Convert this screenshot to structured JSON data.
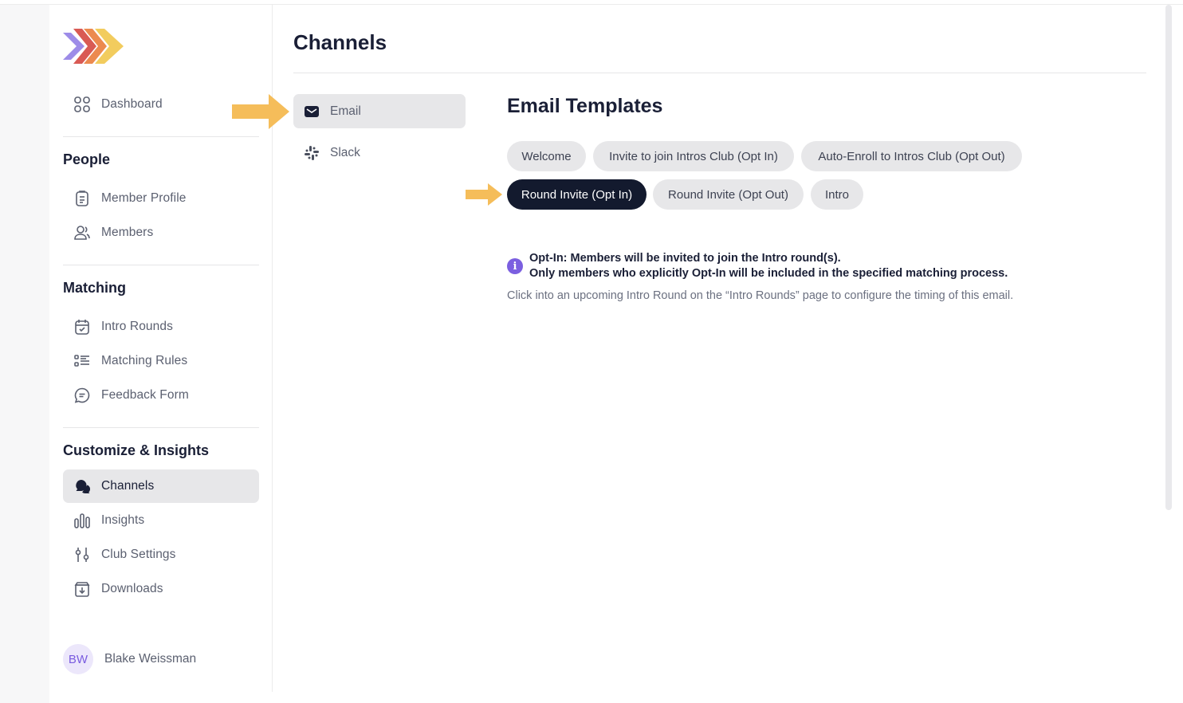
{
  "sidebar": {
    "dashboard_label": "Dashboard",
    "people_title": "People",
    "member_profile_label": "Member Profile",
    "members_label": "Members",
    "matching_title": "Matching",
    "intro_rounds_label": "Intro Rounds",
    "matching_rules_label": "Matching Rules",
    "feedback_form_label": "Feedback Form",
    "customize_title": "Customize & Insights",
    "channels_label": "Channels",
    "insights_label": "Insights",
    "club_settings_label": "Club Settings",
    "downloads_label": "Downloads",
    "user": {
      "initials": "BW",
      "name": "Blake Weissman"
    }
  },
  "page": {
    "title": "Channels"
  },
  "channels": {
    "email_label": "Email",
    "slack_label": "Slack"
  },
  "templates": {
    "heading": "Email Templates",
    "welcome": "Welcome",
    "invite_opt_in": "Invite to join Intros Club (Opt In)",
    "auto_enroll_opt_out": "Auto-Enroll to Intros Club (Opt Out)",
    "round_invite_opt_in": "Round Invite (Opt In)",
    "round_invite_opt_out": "Round Invite (Opt Out)",
    "intro": "Intro"
  },
  "info": {
    "icon_glyph": "i",
    "line1": "Opt-In: Members will be invited to join the Intro round(s).",
    "line2": "Only members who explicitly Opt-In will be included in the specified matching process.",
    "note": "Click into an upcoming Intro Round on the “Intro Rounds” page to configure the timing of this email."
  },
  "colors": {
    "accent": "#7b5fe0",
    "active_pill": "#131a2e",
    "annotation_arrow": "#f5bd5a",
    "inactive_pill": "#e7e7e9"
  }
}
